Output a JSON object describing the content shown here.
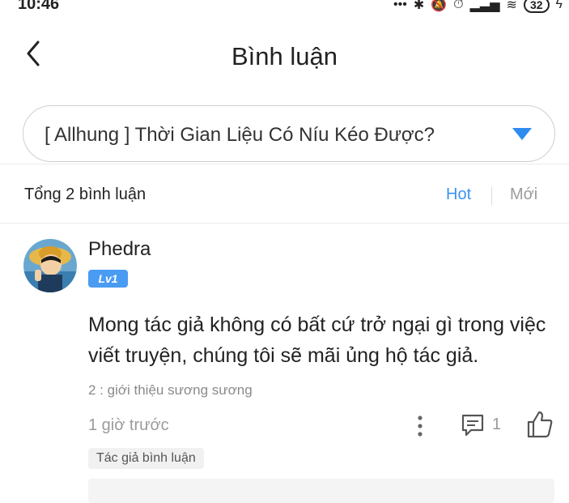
{
  "status_bar": {
    "time": "10:46",
    "battery": "32"
  },
  "header": {
    "title": "Bình luận"
  },
  "chapter_select": {
    "value": "[ Allhung ] Thời Gian Liệu Có Níu Kéo Được?"
  },
  "summary": {
    "total": "Tổng 2 bình luận",
    "sort_hot": "Hot",
    "sort_new": "Mới"
  },
  "comment": {
    "username": "Phedra",
    "level": "Lv1",
    "text": "Mong tác giả không có bất cứ trở ngại gì trong việc viết truyện, chúng tôi sẽ mãi ủng hộ tác giả.",
    "reply_to": "2 : giới thiệu sương sương",
    "time": "1 giờ trước",
    "reply_count": "1",
    "author_tag": "Tác giả bình luận"
  },
  "colors": {
    "accent": "#3d93f0",
    "badge": "#4a9bf2"
  }
}
